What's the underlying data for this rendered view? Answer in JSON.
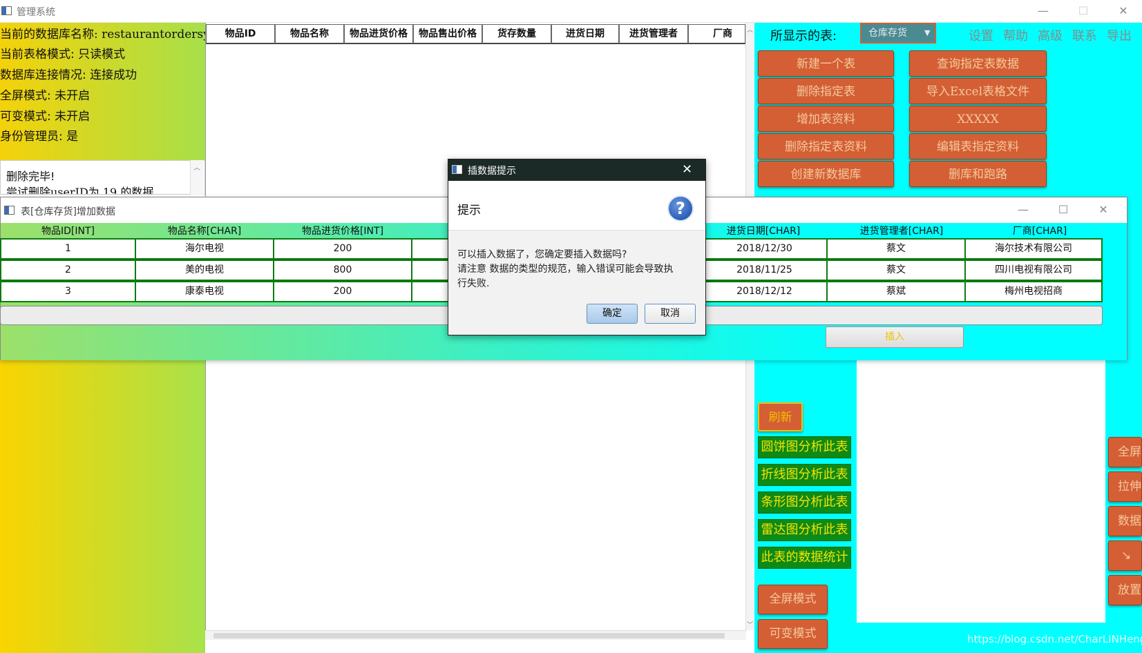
{
  "window": {
    "title": "管理系统"
  },
  "info": {
    "lines": [
      "当前的数据库名称: restaurantordersystem",
      "当前表格模式: 只读模式",
      "数据库连接情况: 连接成功",
      "全屏模式: 未开启",
      "可变模式: 未开启",
      "身份管理员: 是"
    ]
  },
  "log": {
    "lines": [
      "删除完毕!",
      "尝试删除userID为 19 的数据"
    ]
  },
  "main_table": {
    "columns": [
      "物品ID",
      "物品名称",
      "物品进货价格",
      "物品售出价格",
      "货存数量",
      "进货日期",
      "进货管理者",
      "厂商"
    ]
  },
  "right_panel": {
    "shown_table_label": "所显示的表:",
    "selected_table": "仓库存货",
    "top_links": [
      "设置",
      "帮助",
      "高级",
      "联系",
      "导出"
    ],
    "buttons": [
      "新建一个表",
      "查询指定表数据",
      "删除指定表",
      "导入Excel表格文件",
      "增加表资料",
      "XXXXX",
      "删除指定表资料",
      "编辑表指定资料",
      "创建新数据库",
      "删库和跑路"
    ],
    "refresh": "刷新",
    "chart_buttons": [
      "圆饼图分析此表",
      "折线图分析此表",
      "条形图分析此表",
      "雷达图分析此表",
      "此表的数据统计"
    ],
    "fullscreen_mode": "全屏模式",
    "variable_mode": "可变模式",
    "side_buttons": [
      "全屏",
      "拉伸",
      "数据",
      "↘",
      "放置"
    ],
    "watermark": "https://blog.csdn.net/CharLINHeng"
  },
  "insert_window": {
    "title": "表[仓库存货]增加数据",
    "columns": [
      "物品ID[INT]",
      "物品名称[CHAR]",
      "物品进货价格[INT]",
      "进货日期[CHAR]",
      "进货管理者[CHAR]",
      "厂商[CHAR]"
    ],
    "rows": [
      [
        "1",
        "海尔电视",
        "200",
        "2018/12/30",
        "蔡文",
        "海尔技术有限公司"
      ],
      [
        "2",
        "美的电视",
        "800",
        "2018/11/25",
        "蔡文",
        "四川电视有限公司"
      ],
      [
        "3",
        "康泰电视",
        "200",
        "2018/12/12",
        "蔡斌",
        "梅州电视招商"
      ]
    ],
    "insert_button": "插入"
  },
  "dialog": {
    "title": "插数据提示",
    "header": "提示",
    "message_lines": [
      "可以插入数据了，您确定要插入数据吗?",
      "请注意 数据的类型的规范，输入错误可能会导致执",
      "行失败."
    ],
    "ok": "确定",
    "cancel": "取消"
  },
  "colors": {
    "orange_button": "#d45f35",
    "green_button": "#0e8a16",
    "right_panel_bg": "#00ffff",
    "dialog_title_bg": "#1b2a26"
  }
}
